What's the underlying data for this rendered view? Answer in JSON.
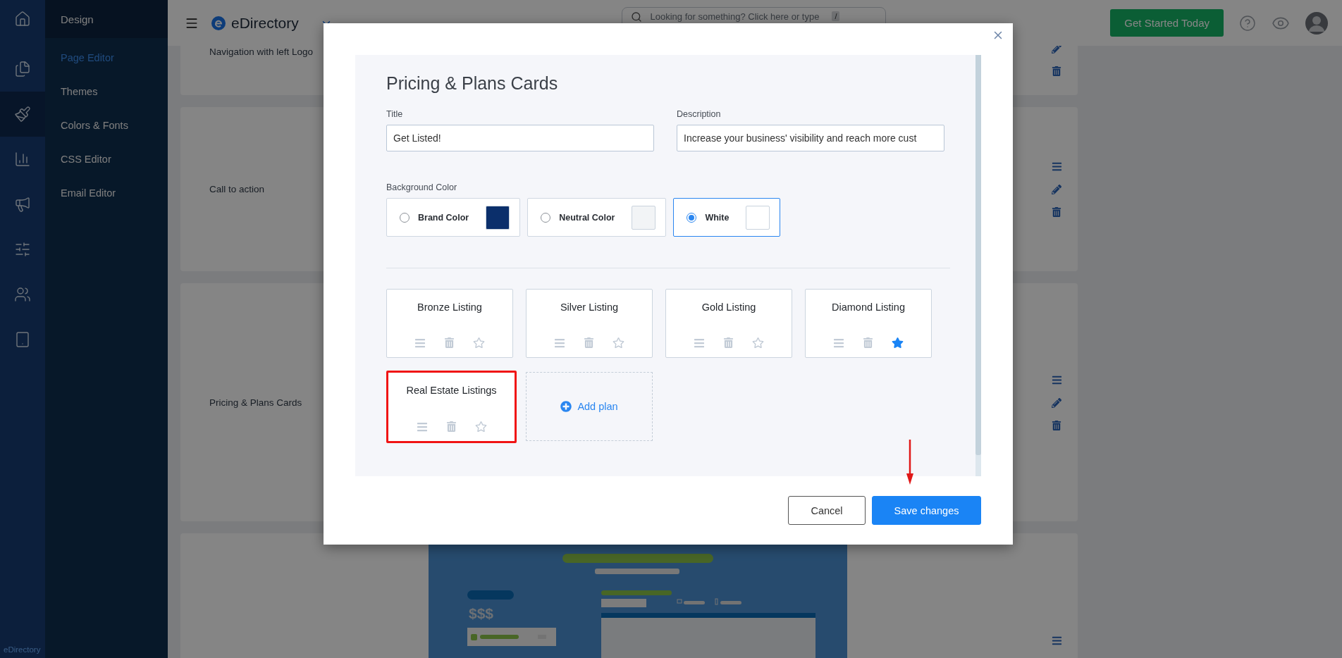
{
  "rail": {
    "items": [
      {
        "selected": false
      },
      {
        "selected": false
      },
      {
        "selected": true
      },
      {
        "selected": false
      },
      {
        "selected": false
      },
      {
        "selected": false
      },
      {
        "selected": false
      },
      {
        "selected": false
      }
    ],
    "footer": "eDirectory"
  },
  "submenu": {
    "title": "Design",
    "items": [
      {
        "label": "Page Editor",
        "selected": true
      },
      {
        "label": "Themes",
        "selected": false
      },
      {
        "label": "Colors & Fonts",
        "selected": false
      },
      {
        "label": "CSS Editor",
        "selected": false
      },
      {
        "label": "Email Editor",
        "selected": false
      }
    ]
  },
  "topbar": {
    "logo_text": "eDirectory",
    "search": {
      "placeholder": "Looking for something? Click here or type",
      "key_hint": "/"
    },
    "cta": "Get Started Today"
  },
  "sections": [
    {
      "kind": "text",
      "label": "Navigation with left Logo"
    },
    {
      "kind": "text",
      "label": "Call to action"
    },
    {
      "kind": "text",
      "label": "Pricing & Plans Cards"
    },
    {
      "kind": "preview",
      "price_text": "$$$"
    }
  ],
  "modal": {
    "title": "Pricing & Plans Cards",
    "fields": [
      {
        "label": "Title",
        "value": "Get Listed!"
      },
      {
        "label": "Description",
        "value": "Increase your business' visibility and reach more cust"
      }
    ],
    "background_label": "Background Color",
    "color_options": [
      {
        "label": "Brand Color",
        "color": "#0b2f6b",
        "selected": false
      },
      {
        "label": "Neutral Color",
        "color": "#f2f4f6",
        "selected": false
      },
      {
        "label": "White",
        "color": "#ffffff",
        "selected": true
      }
    ],
    "plans": [
      {
        "name": "Bronze Listing",
        "featured": false,
        "highlighted": false
      },
      {
        "name": "Silver Listing",
        "featured": false,
        "highlighted": false
      },
      {
        "name": "Gold Listing",
        "featured": false,
        "highlighted": false
      },
      {
        "name": "Diamond Listing",
        "featured": true,
        "highlighted": false
      },
      {
        "name": "Real Estate Listings",
        "featured": false,
        "highlighted": true
      }
    ],
    "add_plan": "Add plan",
    "buttons": [
      {
        "label": "Cancel",
        "kind": "secondary"
      },
      {
        "label": "Save changes",
        "kind": "primary"
      }
    ]
  }
}
